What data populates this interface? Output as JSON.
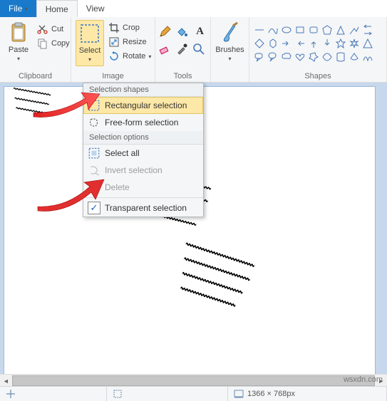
{
  "tabs": {
    "file": "File",
    "home": "Home",
    "view": "View"
  },
  "clipboard": {
    "paste": "Paste",
    "cut": "Cut",
    "copy": "Copy",
    "label": "Clipboard"
  },
  "image": {
    "select": "Select",
    "crop": "Crop",
    "resize": "Resize",
    "rotate": "Rotate",
    "label": "Image"
  },
  "tools": {
    "label": "Tools"
  },
  "brushes": {
    "label": "Brushes"
  },
  "shapes": {
    "label": "Shapes"
  },
  "dropdown": {
    "header1": "Selection shapes",
    "rect": "Rectangular selection",
    "free": "Free-form selection",
    "header2": "Selection options",
    "all": "Select all",
    "invert": "Invert selection",
    "delete": "Delete",
    "transparent": "Transparent selection"
  },
  "status": {
    "dims": "1366 × 768px"
  },
  "watermark": "wsxdn.com"
}
